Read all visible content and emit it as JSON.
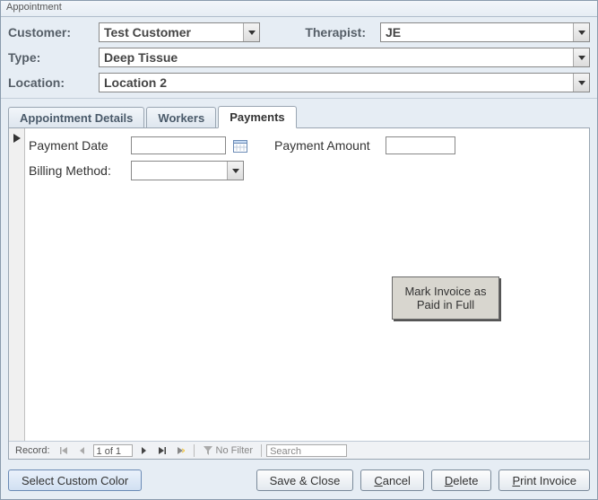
{
  "window": {
    "title": "Appointment"
  },
  "header": {
    "customer_label": "Customer:",
    "customer_value": "Test Customer",
    "therapist_label": "Therapist:",
    "therapist_value": "JE",
    "type_label": "Type:",
    "type_value": "Deep Tissue",
    "location_label": "Location:",
    "location_value": "Location 2"
  },
  "tabs": {
    "appointment_details": "Appointment Details",
    "workers": "Workers",
    "payments": "Payments",
    "active": "Payments"
  },
  "payments": {
    "payment_date_label": "Payment Date",
    "payment_date_value": "",
    "payment_amount_label": "Payment Amount",
    "payment_amount_value": "",
    "billing_method_label": "Billing Method:",
    "billing_method_value": "",
    "mark_paid_label": "Mark Invoice as\nPaid in Full"
  },
  "record_nav": {
    "label": "Record:",
    "count_text": "1 of 1",
    "filter_label": "No Filter",
    "search_placeholder": "Search"
  },
  "bottom_bar": {
    "select_custom_color": "Select Custom Color",
    "save_close": "Save & Close",
    "cancel": "Cancel",
    "delete": "Delete",
    "print_invoice": "Print Invoice"
  }
}
